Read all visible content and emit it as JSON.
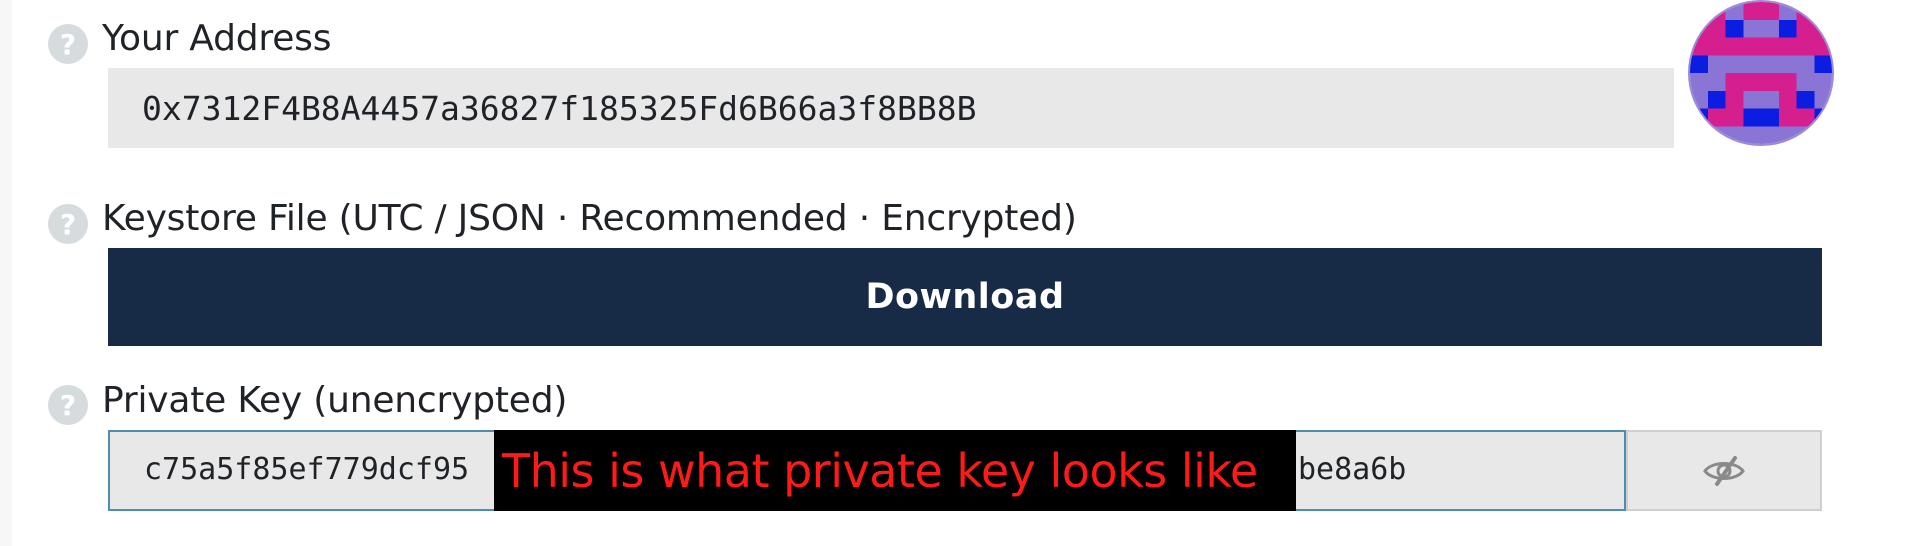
{
  "address": {
    "label": "Your Address",
    "value": "0x7312F4B8A4457a36827f185325Fd6B66a3f8BB8B"
  },
  "keystore": {
    "label": "Keystore File (UTC / JSON · Recommended · Encrypted)",
    "button_label": "Download"
  },
  "private_key": {
    "label": "Private Key (unencrypted)",
    "visible_start": "c75a5f85ef779dcf95",
    "visible_end": "be8a6b",
    "overlay_text": "This is what private key looks like"
  },
  "help_glyph": "?",
  "icons": {
    "help": "question-circle-icon",
    "visibility": "eye-slash-icon",
    "identicon": "identicon-avatar"
  },
  "colors": {
    "button_bg": "#172a46",
    "overlay_bg": "#000000",
    "overlay_text": "#ff1a1a",
    "identicon_pink": "#d61f8f",
    "identicon_purple": "#8a74d6",
    "identicon_blue": "#0a1de0"
  }
}
